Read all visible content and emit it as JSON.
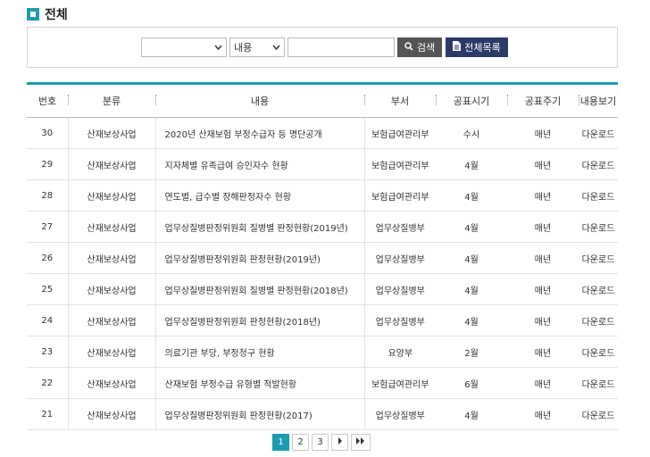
{
  "page": {
    "title": "전체"
  },
  "search": {
    "category_value": "",
    "field_value": "내용",
    "keyword_value": "",
    "search_label": "검색",
    "list_label": "전체목록"
  },
  "table": {
    "headers": [
      "번호",
      "분류",
      "내용",
      "부서",
      "공표시기",
      "공표주기",
      "내용보기"
    ],
    "rows": [
      {
        "no": "30",
        "category": "산재보상사업",
        "title": "2020년 산재보험 부정수급자 등 명단공개",
        "dept": "보험급여관리부",
        "timing": "수시",
        "cycle": "매년",
        "view": "다운로드"
      },
      {
        "no": "29",
        "category": "산재보상사업",
        "title": "지자체별 유족급여 승인자수 현황",
        "dept": "보험급여관리부",
        "timing": "4월",
        "cycle": "매년",
        "view": "다운로드"
      },
      {
        "no": "28",
        "category": "산재보상사업",
        "title": "연도별, 급수별 장해판정자수 현황",
        "dept": "보험급여관리부",
        "timing": "4월",
        "cycle": "매년",
        "view": "다운로드"
      },
      {
        "no": "27",
        "category": "산재보상사업",
        "title": "업무상질병판정위원회 질병별 판정현황(2019년)",
        "dept": "업무상질병부",
        "timing": "4월",
        "cycle": "매년",
        "view": "다운로드"
      },
      {
        "no": "26",
        "category": "산재보상사업",
        "title": "업무상질병판정위원회 판정현황(2019년)",
        "dept": "업무상질병부",
        "timing": "4월",
        "cycle": "매년",
        "view": "다운로드"
      },
      {
        "no": "25",
        "category": "산재보상사업",
        "title": "업무상질병판정위원회 질병별 판정현황(2018년)",
        "dept": "업무상질병부",
        "timing": "4월",
        "cycle": "매년",
        "view": "다운로드"
      },
      {
        "no": "24",
        "category": "산재보상사업",
        "title": "업무상질병판정위원회 판정현황(2018년)",
        "dept": "업무상질병부",
        "timing": "4월",
        "cycle": "매년",
        "view": "다운로드"
      },
      {
        "no": "23",
        "category": "산재보상사업",
        "title": "의료기관 부당, 부정청구 현황",
        "dept": "요양부",
        "timing": "2월",
        "cycle": "매년",
        "view": "다운로드"
      },
      {
        "no": "22",
        "category": "산재보상사업",
        "title": "산재보험 부정수급 유형별 적발현황",
        "dept": "보험급여관리부",
        "timing": "6월",
        "cycle": "매년",
        "view": "다운로드"
      },
      {
        "no": "21",
        "category": "산재보상사업",
        "title": "업무상질병판정위원회 판정현황(2017)",
        "dept": "업무상질병부",
        "timing": "4월",
        "cycle": "매년",
        "view": "다운로드"
      }
    ]
  },
  "pagination": {
    "pages": [
      "1",
      "2",
      "3"
    ],
    "current": "1",
    "next_icon": "next-arrow-icon",
    "last_icon": "last-page-icon"
  },
  "colors": {
    "accent": "#1a9bb0",
    "list_button": "#2b3a67",
    "search_button": "#555555"
  }
}
